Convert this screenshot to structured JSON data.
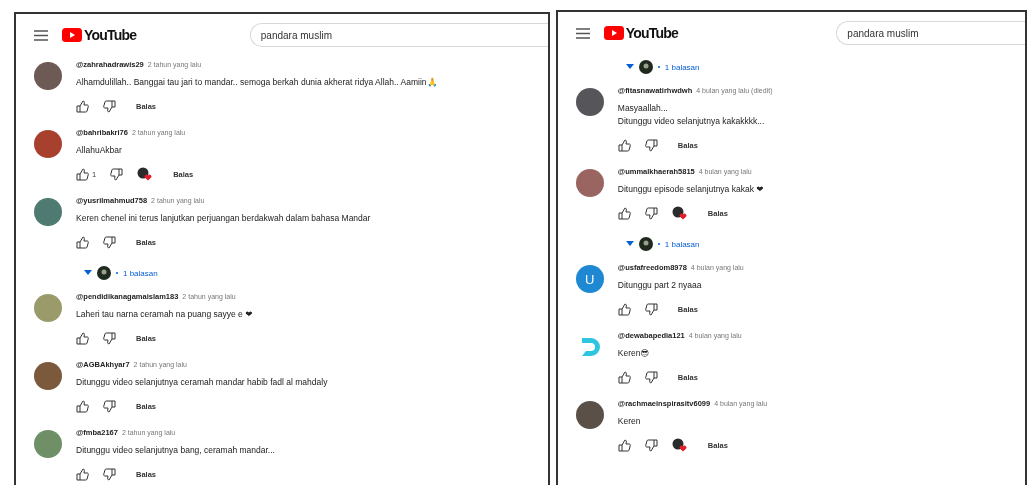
{
  "panels": [
    {
      "logo": "YouTube",
      "search": {
        "value": "pandara muslim"
      },
      "items": [
        {
          "kind": "comment",
          "avatar": {
            "kind": "photo",
            "color": "#6e5a55"
          },
          "handle": "@zahrahadrawis29",
          "time": "2 tahun yang lalu",
          "lines": [
            "Alhamdulillah.. Banggai tau jari to mandar.. semoga berkah dunia akherat ridya Allah.. Aamiin🙏"
          ],
          "creator_heart": false,
          "reply": "Balas"
        },
        {
          "kind": "comment",
          "avatar": {
            "kind": "photo",
            "color": "#a8402e"
          },
          "handle": "@bahribakri76",
          "time": "2 tahun yang lalu",
          "lines": [
            "AllahuAkbar"
          ],
          "likes": "1",
          "creator_heart": true,
          "reply": "Balas"
        },
        {
          "kind": "comment",
          "avatar": {
            "kind": "photo",
            "color": "#4f7a72"
          },
          "handle": "@yusrilmahmud758",
          "time": "2 tahun yang lalu",
          "lines": [
            "Keren chenel ini terus lanjutkan perjuangan berdakwah dalam bahasa Mandar"
          ],
          "creator_heart": false,
          "reply": "Balas"
        },
        {
          "kind": "replies",
          "label": "1 balasan"
        },
        {
          "kind": "comment",
          "avatar": {
            "kind": "photo",
            "color": "#9a9a6a"
          },
          "handle": "@pendidikanagamaislam183",
          "time": "2 tahun yang lalu",
          "lines": [
            "Laheri tau narna ceramah na puang sayye e ❤"
          ],
          "creator_heart": false,
          "reply": "Balas"
        },
        {
          "kind": "comment",
          "avatar": {
            "kind": "photo",
            "color": "#7a5a3a"
          },
          "handle": "@AGBAkhyar7",
          "time": "2 tahun yang lalu",
          "lines": [
            "Ditunggu video selanjutnya ceramah mandar habib fadl al mahdaly"
          ],
          "creator_heart": false,
          "reply": "Balas"
        },
        {
          "kind": "comment",
          "avatar": {
            "kind": "photo",
            "color": "#6f8f66"
          },
          "handle": "@fmba2167",
          "time": "2 tahun yang lalu",
          "lines": [
            "Ditunggu video selanjutnya bang, ceramah mandar..."
          ],
          "creator_heart": false,
          "reply": "Balas"
        }
      ]
    },
    {
      "logo": "YouTube",
      "search": {
        "value": "pandara muslim"
      },
      "items": [
        {
          "kind": "replies",
          "label": "1 balasan"
        },
        {
          "kind": "comment",
          "avatar": {
            "kind": "photo",
            "color": "#55555a"
          },
          "handle": "@fitasnawatirhwdwh",
          "time": "4 bulan yang lalu (diedit)",
          "lines": [
            "Masyaallah...",
            "Ditunggu video selanjutnya kakakkkk..."
          ],
          "creator_heart": false,
          "reply": "Balas"
        },
        {
          "kind": "comment",
          "avatar": {
            "kind": "photo",
            "color": "#9a6560"
          },
          "handle": "@ummalkhaerah5815",
          "time": "4 bulan yang lalu",
          "lines": [
            "Ditunggu episode selanjutnya kakak ❤"
          ],
          "creator_heart": true,
          "reply": "Balas"
        },
        {
          "kind": "replies",
          "label": "1 balasan"
        },
        {
          "kind": "comment",
          "avatar": {
            "kind": "letter",
            "color": "#1e88d2",
            "letter": "U"
          },
          "handle": "@usfafreedom8978",
          "time": "4 bulan yang lalu",
          "lines": [
            "Ditunggu part 2 nyaaa"
          ],
          "creator_heart": false,
          "reply": "Balas"
        },
        {
          "kind": "comment",
          "avatar": {
            "kind": "logo",
            "color": "#2ec5e0"
          },
          "handle": "@dewabapedia121",
          "time": "4 bulan yang lalu",
          "lines": [
            "Keren😎"
          ],
          "creator_heart": false,
          "reply": "Balas"
        },
        {
          "kind": "comment",
          "avatar": {
            "kind": "photo",
            "color": "#5a5048"
          },
          "handle": "@rachmaeinspirasitv6099",
          "time": "4 bulan yang lalu",
          "lines": [
            "Keren"
          ],
          "creator_heart": true,
          "reply": "Balas"
        }
      ]
    }
  ]
}
